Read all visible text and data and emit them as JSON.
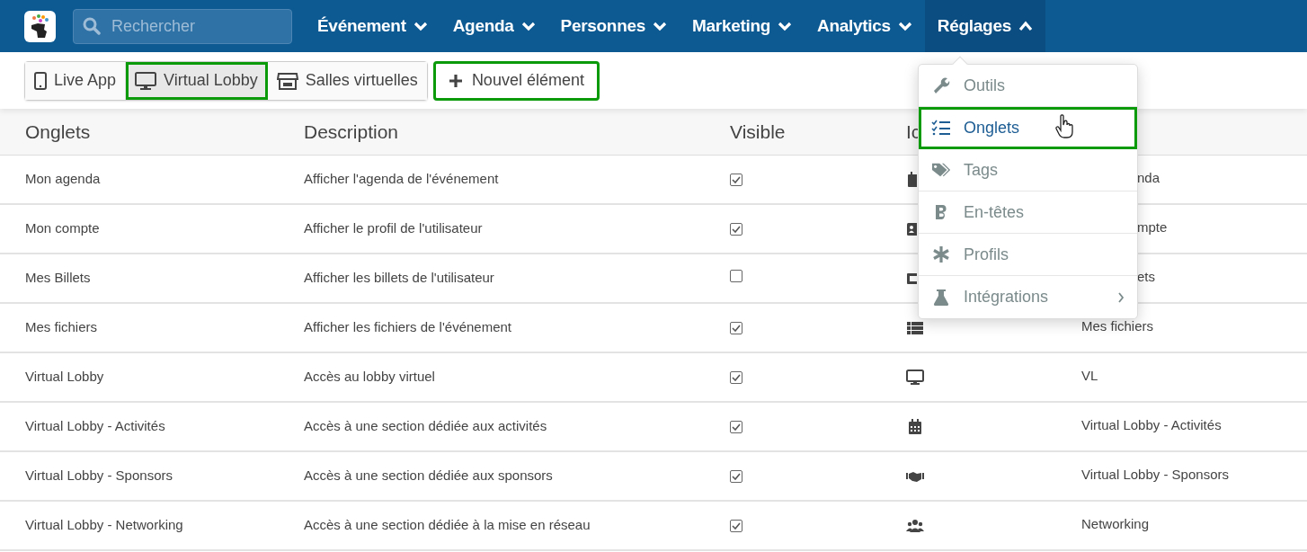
{
  "navbar": {
    "search": {
      "placeholder": "Rechercher"
    },
    "menus": [
      {
        "label": "Événement",
        "expanded": false
      },
      {
        "label": "Agenda",
        "expanded": false
      },
      {
        "label": "Personnes",
        "expanded": false
      },
      {
        "label": "Marketing",
        "expanded": false
      },
      {
        "label": "Analytics",
        "expanded": false
      },
      {
        "label": "Réglages",
        "expanded": true
      }
    ]
  },
  "toolbar": {
    "views": [
      {
        "label": "Live App",
        "selected": false,
        "highlighted": false
      },
      {
        "label": "Virtual Lobby",
        "selected": true,
        "highlighted": true
      },
      {
        "label": "Salles virtuelles",
        "selected": false,
        "highlighted": false
      }
    ],
    "new_button": {
      "label": "Nouvel élément",
      "highlighted": true
    }
  },
  "table": {
    "columns": [
      "Onglets",
      "Description",
      "Visible",
      "Ic"
    ],
    "rows": [
      {
        "tab": "Mon agenda",
        "description": "Afficher l'agenda de l'événement",
        "visible": true,
        "covered": true,
        "column_5": "nda"
      },
      {
        "tab": "Mon compte",
        "description": "Afficher le profil de l'utilisateur",
        "visible": true,
        "covered": true,
        "column_5": "mpte"
      },
      {
        "tab": "Mes Billets",
        "description": "Afficher les billets de l'utilisateur",
        "visible": false,
        "covered": true,
        "column_5": "ets"
      },
      {
        "tab": "Mes fichiers",
        "description": "Afficher les fichiers de l'événement",
        "visible": true,
        "covered": false,
        "column_5": "Mes fichiers"
      },
      {
        "tab": "Virtual Lobby",
        "description": "Accès au lobby virtuel",
        "visible": true,
        "covered": false,
        "column_5": "VL"
      },
      {
        "tab": "Virtual Lobby - Activités",
        "description": "Accès à une section dédiée aux activités",
        "visible": true,
        "covered": false,
        "column_5": "Virtual Lobby - Activités"
      },
      {
        "tab": "Virtual Lobby - Sponsors",
        "description": "Accès à une section dédiée aux sponsors",
        "visible": true,
        "covered": false,
        "column_5": "Virtual Lobby - Sponsors"
      },
      {
        "tab": "Virtual Lobby - Networking",
        "description": "Accès à une section dédiée à la mise en réseau",
        "visible": true,
        "covered": false,
        "column_5": "Networking"
      }
    ]
  },
  "settings_menu": [
    {
      "label": "Outils",
      "selected": false,
      "submenu": false
    },
    {
      "label": "Onglets",
      "selected": true,
      "submenu": false
    },
    {
      "label": "Tags",
      "selected": false,
      "submenu": false
    },
    {
      "label": "En-têtes",
      "selected": false,
      "submenu": false
    },
    {
      "label": "Profils",
      "selected": false,
      "submenu": false
    },
    {
      "label": "Intégrations",
      "selected": false,
      "submenu": true
    }
  ]
}
